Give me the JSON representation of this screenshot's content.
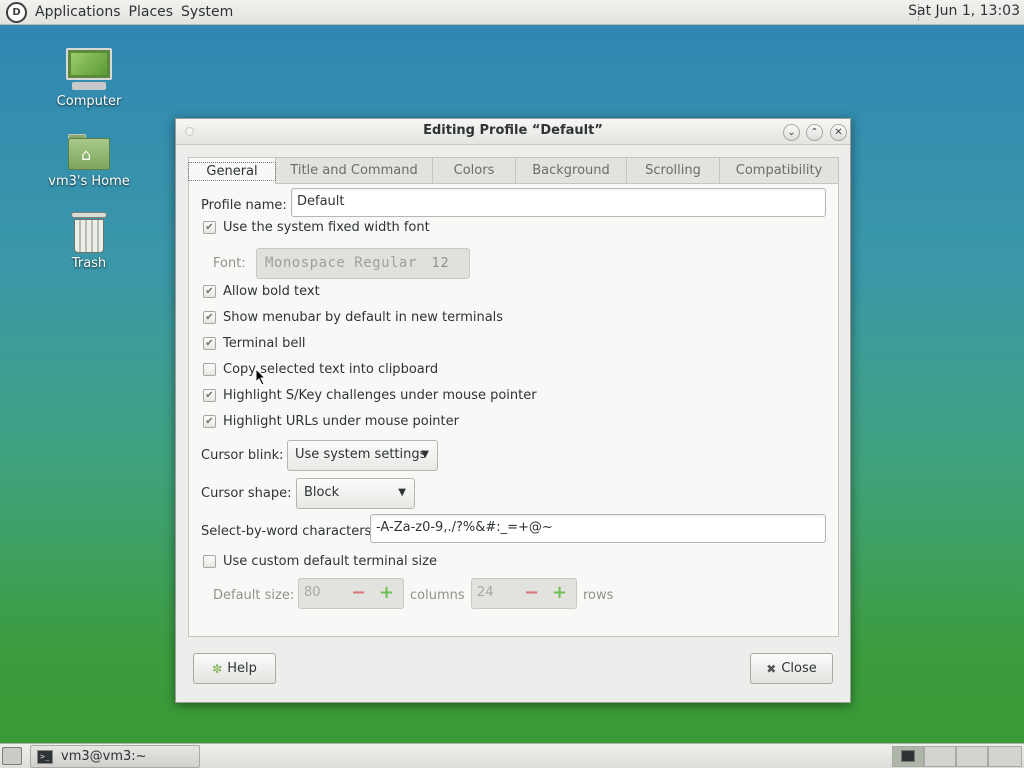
{
  "top_panel": {
    "menus": [
      "Applications",
      "Places",
      "System"
    ],
    "clock": "Sat Jun  1, 13:03"
  },
  "desktop": {
    "icons": [
      {
        "label": "Computer",
        "icon": "computer-icon"
      },
      {
        "label": "vm3's Home",
        "icon": "home-folder-icon"
      },
      {
        "label": "Trash",
        "icon": "trash-icon"
      }
    ]
  },
  "dialog": {
    "title": "Editing Profile “Default”",
    "tabs": [
      "General",
      "Title and Command",
      "Colors",
      "Background",
      "Scrolling",
      "Compatibility"
    ],
    "active_tab": "General",
    "general": {
      "profile_name_label": "Profile name:",
      "profile_name_value": "Default",
      "use_system_font_label": "Use the system fixed width font",
      "use_system_font_checked": true,
      "font_label": "Font:",
      "font_value": "Monospace Regular",
      "font_size": "12",
      "allow_bold_label": "Allow bold text",
      "allow_bold_checked": true,
      "show_menubar_label": "Show menubar by default in new terminals",
      "show_menubar_checked": true,
      "terminal_bell_label": "Terminal bell",
      "terminal_bell_checked": true,
      "copy_selected_label": "Copy selected text into clipboard",
      "copy_selected_checked": false,
      "highlight_skey_label": "Highlight S/Key challenges under mouse pointer",
      "highlight_skey_checked": true,
      "highlight_urls_label": "Highlight URLs under mouse pointer",
      "highlight_urls_checked": true,
      "cursor_blink_label": "Cursor blink:",
      "cursor_blink_value": "Use system settings",
      "cursor_shape_label": "Cursor shape:",
      "cursor_shape_value": "Block",
      "select_by_word_label": "Select-by-word characters:",
      "select_by_word_value": "-A-Za-z0-9,./?%&#:_=+@~",
      "custom_size_label": "Use custom default terminal size",
      "custom_size_checked": false,
      "default_size_label": "Default size:",
      "columns_value": "80",
      "columns_label": "columns",
      "rows_value": "24",
      "rows_label": "rows"
    },
    "help_label": "Help",
    "close_label": "Close"
  },
  "bottom_panel": {
    "task_label": "vm3@vm3:~"
  }
}
